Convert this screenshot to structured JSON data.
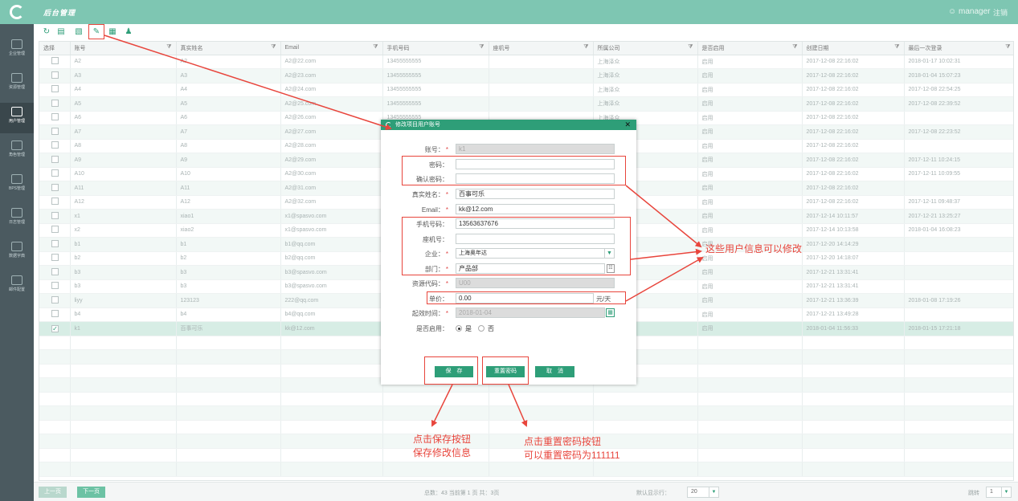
{
  "header": {
    "app_title": "后台管理",
    "user": "manager",
    "logout": "注销"
  },
  "sidebar": {
    "items": [
      {
        "label": "企业管理",
        "icon": "building-icon"
      },
      {
        "label": "资源管理",
        "icon": "resource-icon"
      },
      {
        "label": "用户管理",
        "icon": "users-icon",
        "active": true
      },
      {
        "label": "角色管理",
        "icon": "role-icon"
      },
      {
        "label": "BPS管理",
        "icon": "bps-icon"
      },
      {
        "label": "日志管理",
        "icon": "log-icon"
      },
      {
        "label": "数据字典",
        "icon": "dictionary-icon"
      },
      {
        "label": "邮件配置",
        "icon": "mail-icon"
      }
    ]
  },
  "toolbar": {
    "buttons": [
      {
        "name": "refresh",
        "icon": "refresh-icon"
      },
      {
        "name": "add",
        "icon": "add-file-icon"
      },
      {
        "name": "delete",
        "icon": "trash-icon"
      },
      {
        "name": "edit",
        "icon": "edit-icon"
      },
      {
        "name": "export",
        "icon": "export-icon"
      },
      {
        "name": "user-settings",
        "icon": "user-gear-icon"
      }
    ]
  },
  "table": {
    "columns": [
      "选择",
      "账号",
      "真实姓名",
      "Email",
      "手机号码",
      "座机号",
      "所属公司",
      "是否启用",
      "创建日期",
      "最后一次登录"
    ],
    "rows": [
      [
        "",
        "A2",
        "A2",
        "A2@22.com",
        "13455555555",
        "",
        "上海泽众",
        "启用",
        "2017-12-08 22:16:02",
        "2018-01-17 10:02:31"
      ],
      [
        "",
        "A3",
        "A3",
        "A2@23.com",
        "13455555555",
        "",
        "上海泽众",
        "启用",
        "2017-12-08 22:16:02",
        "2018-01-04 15:07:23"
      ],
      [
        "",
        "A4",
        "A4",
        "A2@24.com",
        "13455555555",
        "",
        "上海泽众",
        "启用",
        "2017-12-08 22:16:02",
        "2017-12-08 22:54:25"
      ],
      [
        "",
        "A5",
        "A5",
        "A2@25.com",
        "13455555555",
        "",
        "上海泽众",
        "启用",
        "2017-12-08 22:16:02",
        "2017-12-08 22:39:52"
      ],
      [
        "",
        "A6",
        "A6",
        "A2@26.com",
        "13455555555",
        "",
        "上海泽众",
        "启用",
        "2017-12-08 22:16:02",
        ""
      ],
      [
        "",
        "A7",
        "A7",
        "A2@27.com",
        "",
        "",
        "",
        "启用",
        "2017-12-08 22:16:02",
        "2017-12-08 22:23:52"
      ],
      [
        "",
        "A8",
        "A8",
        "A2@28.com",
        "",
        "",
        "",
        "启用",
        "2017-12-08 22:16:02",
        ""
      ],
      [
        "",
        "A9",
        "A9",
        "A2@29.com",
        "",
        "",
        "",
        "启用",
        "2017-12-08 22:16:02",
        "2017-12-11 10:24:15"
      ],
      [
        "",
        "A10",
        "A10",
        "A2@30.com",
        "",
        "",
        "",
        "启用",
        "2017-12-08 22:16:02",
        "2017-12-11 10:09:55"
      ],
      [
        "",
        "A11",
        "A11",
        "A2@31.com",
        "",
        "",
        "",
        "启用",
        "2017-12-08 22:16:02",
        ""
      ],
      [
        "",
        "A12",
        "A12",
        "A2@32.com",
        "",
        "",
        "",
        "启用",
        "2017-12-08 22:16:02",
        "2017-12-11 09:48:37"
      ],
      [
        "",
        "x1",
        "xiao1",
        "x1@spasvo.com",
        "",
        "",
        "",
        "启用",
        "2017-12-14 10:11:57",
        "2017-12-21 13:25:27"
      ],
      [
        "",
        "x2",
        "xiao2",
        "x1@spasvo.com",
        "",
        "",
        "",
        "启用",
        "2017-12-14 10:13:58",
        "2018-01-04 16:08:23"
      ],
      [
        "",
        "b1",
        "b1",
        "b1@qq.com",
        "",
        "",
        "",
        "启用",
        "2017-12-20 14:14:29",
        ""
      ],
      [
        "",
        "b2",
        "b2",
        "b2@qq.com",
        "",
        "",
        "",
        "启用",
        "2017-12-20 14:18:07",
        ""
      ],
      [
        "",
        "b3",
        "b3",
        "b3@spasvo.com",
        "",
        "",
        "",
        "启用",
        "2017-12-21 13:31:41",
        ""
      ],
      [
        "",
        "b3",
        "b3",
        "b3@spasvo.com",
        "",
        "",
        "",
        "启用",
        "2017-12-21 13:31:41",
        ""
      ],
      [
        "",
        "liyy",
        "123123",
        "222@qq.com",
        "",
        "",
        "",
        "启用",
        "2017-12-21 13:36:39",
        "2018-01-08 17:19:26"
      ],
      [
        "",
        "b4",
        "b4",
        "b4@qq.com",
        "",
        "",
        "",
        "启用",
        "2017-12-21 13:49:28",
        ""
      ],
      [
        "✓",
        "k1",
        "百事可乐",
        "kk@12.com",
        "",
        "",
        "",
        "启用",
        "2018-01-04 11:56:33",
        "2018-01-15 17:21:18"
      ]
    ],
    "selected_row": 19,
    "empty_rows": 10
  },
  "footer": {
    "prev": "上一页",
    "next": "下一页",
    "summary": "总数：43   当前第 1 页    共：3页",
    "page_size_label": "默认显示行：",
    "page_size": "20",
    "jump_label": "跳转",
    "jump_page": "1"
  },
  "modal": {
    "title": "修改项目用户账号",
    "fields": {
      "account": {
        "label": "账号：",
        "value": "k1",
        "required": true
      },
      "password": {
        "label": "密码：",
        "value": ""
      },
      "confirm_password": {
        "label": "确认密码：",
        "value": ""
      },
      "real_name": {
        "label": "真实姓名：",
        "value": "百事可乐",
        "required": true
      },
      "email": {
        "label": "Email：",
        "value": "kk@12.com",
        "required": true
      },
      "mobile": {
        "label": "手机号码：",
        "value": "13563637676"
      },
      "phone": {
        "label": "座机号：",
        "value": ""
      },
      "company": {
        "label": "企业：",
        "value": "上海奥年达",
        "required": true
      },
      "department": {
        "label": "部门：",
        "value": "产品部",
        "required": true
      },
      "resource_code": {
        "label": "资源代码：",
        "value": "U00",
        "required": true
      },
      "unit_price": {
        "label": "单价：",
        "value": "0.00",
        "unit": "元/天"
      },
      "start_time": {
        "label": "起效时间：",
        "value": "2018-01-04",
        "required": true
      },
      "enabled": {
        "label": "是否启用：",
        "yes": "是",
        "no": "否",
        "value": "yes"
      }
    },
    "buttons": {
      "save": "保　存",
      "reset_password": "重置密码",
      "cancel": "取　消"
    }
  },
  "annotations": {
    "user_info": "这些用户信息可以修改",
    "save_line1": "点击保存按钮",
    "save_line2": "保存修改信息",
    "reset_line1": "点击重置密码按钮",
    "reset_line2": "可以重置密码为111111",
    "color": "#e8453c"
  },
  "colors": {
    "header": "#7ec6b2",
    "sidebar": "#4b5a60",
    "accent": "#2e9e78"
  }
}
